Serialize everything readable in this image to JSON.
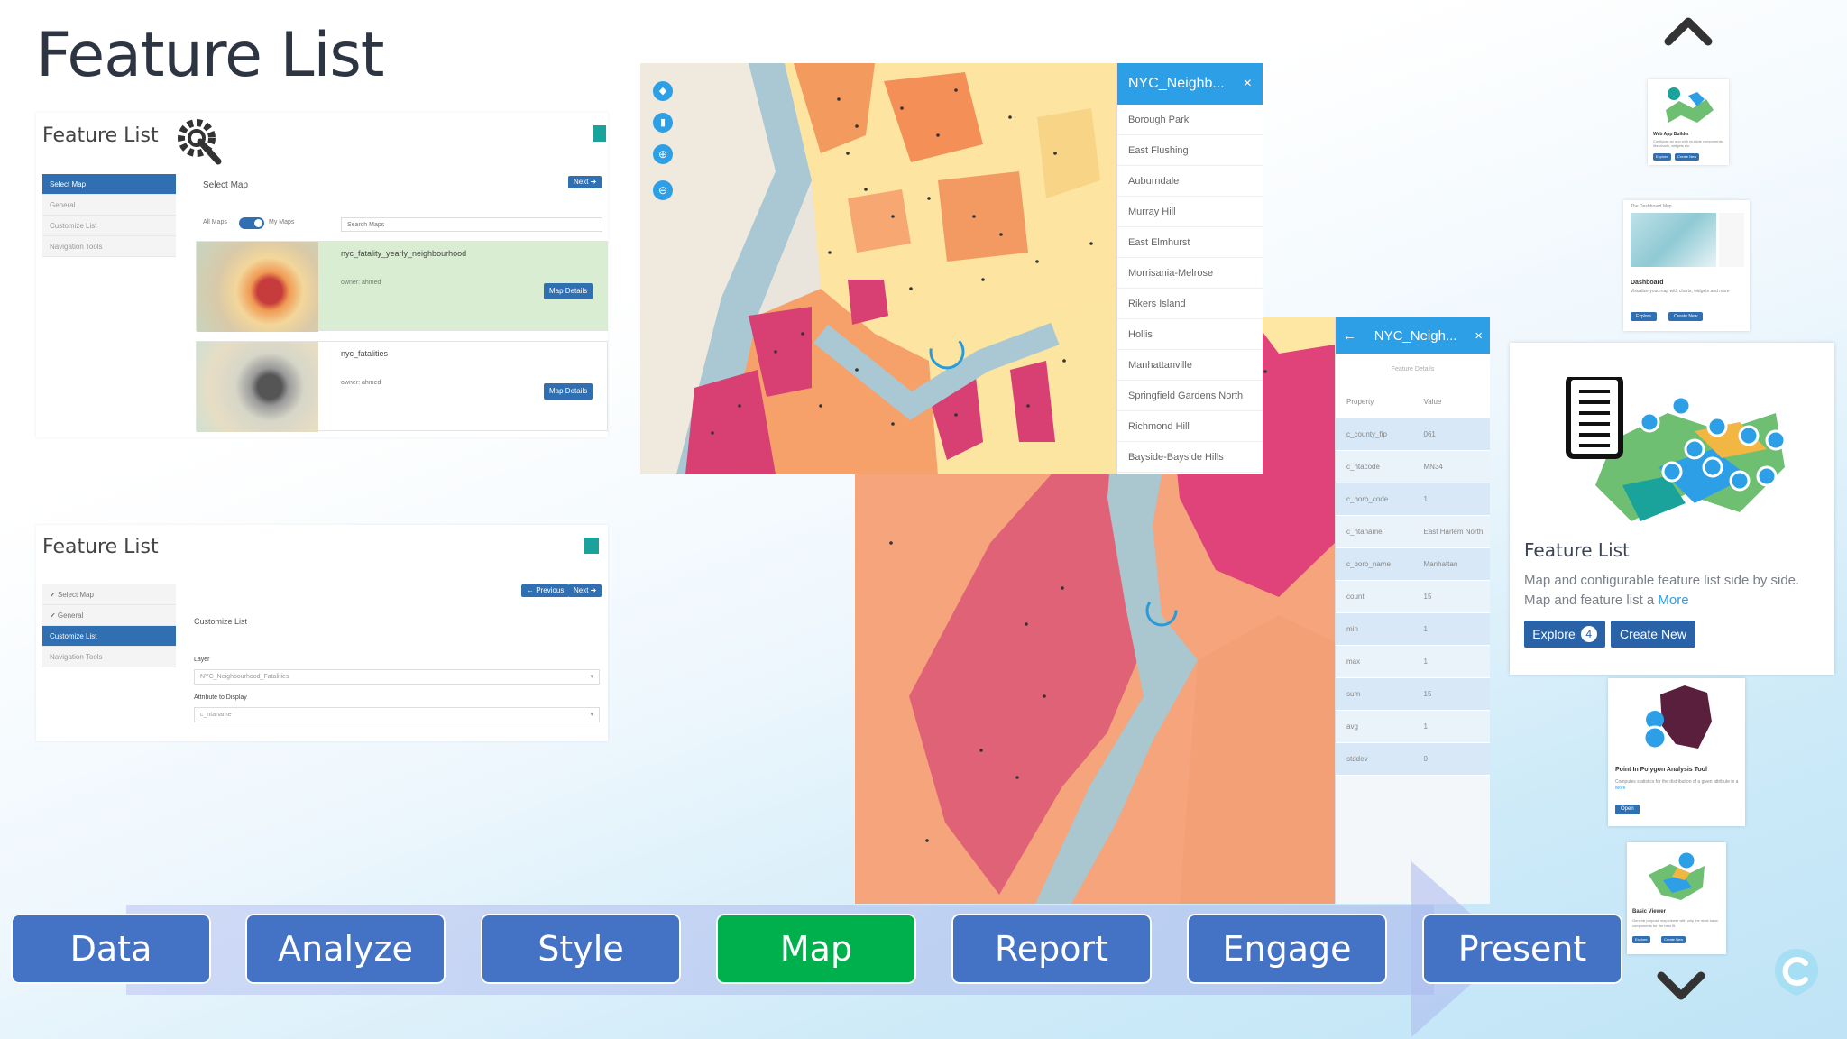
{
  "page_title": "Feature List",
  "setup_panel_1": {
    "title": "Feature List",
    "sidebar": [
      "Select Map",
      "General",
      "Customize List",
      "Navigation Tools"
    ],
    "section": "Select Map",
    "next": "Next ➔",
    "toggle_all": "All Maps",
    "toggle_my": "My Maps",
    "search_placeholder": "Search Maps",
    "maps": [
      {
        "name": "nyc_fatality_yearly_neighbourhood",
        "owner": "owner: ahmed",
        "button": "Map Details"
      },
      {
        "name": "nyc_fatalities",
        "owner": "owner: ahmed",
        "button": "Map Details"
      }
    ]
  },
  "setup_panel_2": {
    "title": "Feature List",
    "sidebar": [
      "✔ Select Map",
      "✔ General",
      "Customize List",
      "Navigation Tools"
    ],
    "previous": "← Previous",
    "next": "Next ➔",
    "section": "Customize List",
    "layer_label": "Layer",
    "layer_value": "NYC_Neighbourhood_Fatalities",
    "attr_label": "Attribute to Display",
    "attr_value": "c_ntaname"
  },
  "map1": {
    "list_title": "NYC_Neighb...",
    "close": "×",
    "items": [
      "Borough Park",
      "East Flushing",
      "Auburndale",
      "Murray Hill",
      "East Elmhurst",
      "Morrisania-Melrose",
      "Rikers Island",
      "Hollis",
      "Manhattanville",
      "Springfield Gardens North",
      "Richmond Hill",
      "Bayside-Bayside Hills"
    ]
  },
  "map2": {
    "back": "←",
    "title": "NYC_Neigh...",
    "close": "×",
    "subtitle": "Feature Details",
    "header": [
      "Property",
      "Value"
    ],
    "rows": [
      [
        "c_county_fip",
        "061"
      ],
      [
        "c_ntacode",
        "MN34"
      ],
      [
        "c_boro_code",
        "1"
      ],
      [
        "c_ntaname",
        "East Harlem North"
      ],
      [
        "c_boro_name",
        "Manhattan"
      ],
      [
        "count",
        "15"
      ],
      [
        "min",
        "1"
      ],
      [
        "max",
        "1"
      ],
      [
        "sum",
        "15"
      ],
      [
        "avg",
        "1"
      ],
      [
        "stddev",
        "0"
      ]
    ]
  },
  "workflow": [
    "Data",
    "Analyze",
    "Style",
    "Map",
    "Report",
    "Engage",
    "Present"
  ],
  "gallery": {
    "top_card": {
      "title": "Web App Builder",
      "desc": "Configure an app with multiple components like charts, widgets etc.",
      "btn1": "Explore",
      "btn2": "Create New"
    },
    "dashboard_card": {
      "header": "The Dashboard Map",
      "title": "Dashboard",
      "desc": "Visualize your map with charts, widgets and more",
      "btn1": "Explore",
      "btn2": "Create New"
    },
    "main_card": {
      "title": "Feature List",
      "desc": "Map and configurable feature list side by side. Map and feature list a ",
      "more": "More",
      "explore": "Explore",
      "explore_count": "4",
      "create": "Create New"
    },
    "pip_card": {
      "title": "Point In Polygon Analysis Tool",
      "desc": "Computes statistics for the distribution of a given attribute in a ",
      "more": "More",
      "btn": "Open"
    },
    "basic_card": {
      "title": "Basic Viewer",
      "desc": "General purpose map viewer with only the most basic components for the best fit.",
      "btn1": "Explore",
      "btn2": "Create New"
    }
  }
}
